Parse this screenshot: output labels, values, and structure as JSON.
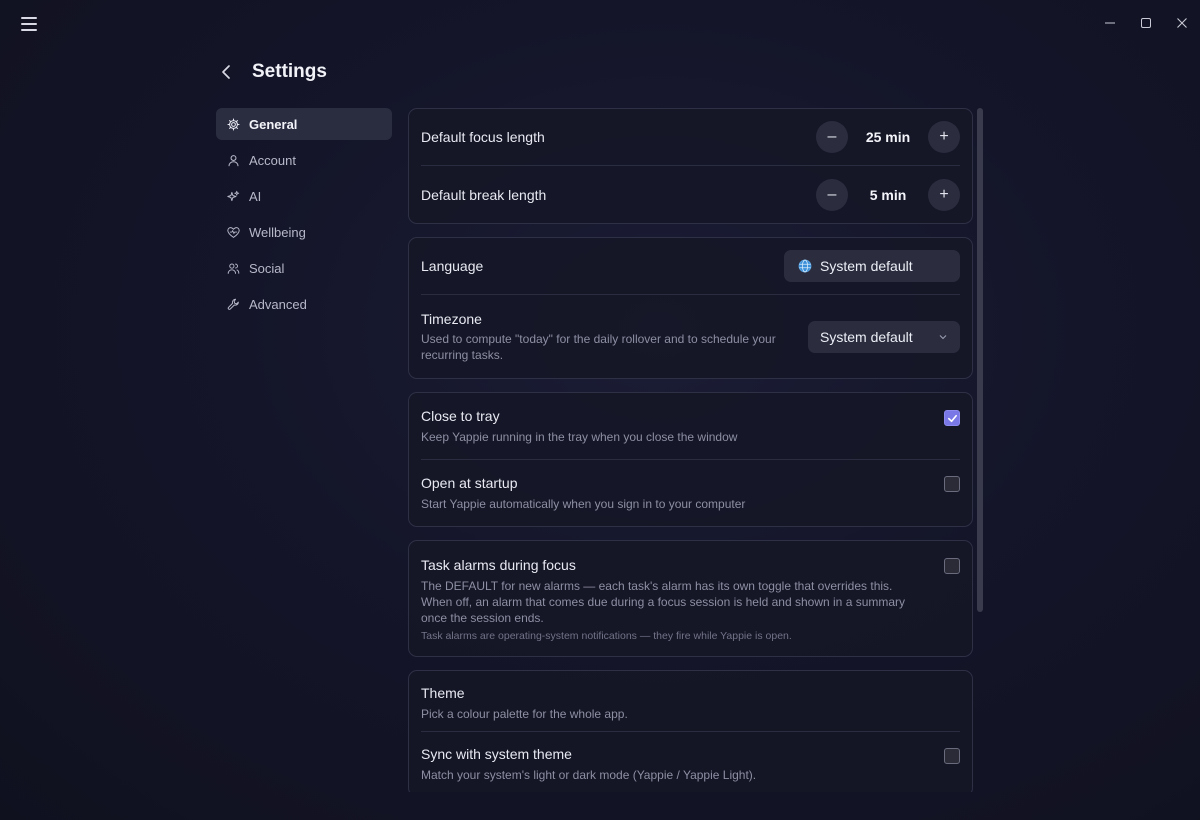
{
  "window": {
    "menu_icon": "hamburger-menu-icon",
    "minimize_icon": "minimize-icon",
    "maximize_icon": "maximize-icon",
    "close_icon": "close-icon"
  },
  "header": {
    "title": "Settings",
    "back_icon": "chevron-left-icon"
  },
  "sidebar": {
    "items": [
      {
        "label": "General",
        "icon": "gear-icon",
        "active": true
      },
      {
        "label": "Account",
        "icon": "user-icon",
        "active": false
      },
      {
        "label": "AI",
        "icon": "sparkles-icon",
        "active": false
      },
      {
        "label": "Wellbeing",
        "icon": "heart-pulse-icon",
        "active": false
      },
      {
        "label": "Social",
        "icon": "users-icon",
        "active": false
      },
      {
        "label": "Advanced",
        "icon": "wrench-icon",
        "active": false
      }
    ]
  },
  "timers": {
    "focus": {
      "label": "Default focus length",
      "value": "25 min"
    },
    "break": {
      "label": "Default break length",
      "value": "5 min"
    }
  },
  "locale": {
    "language": {
      "label": "Language",
      "value": "System default",
      "icon": "globe-icon"
    },
    "timezone": {
      "label": "Timezone",
      "description": "Used to compute \"today\" for the daily rollover and to schedule your recurring tasks.",
      "value": "System default"
    }
  },
  "window_behaviour": {
    "close_to_tray": {
      "label": "Close to tray",
      "description": "Keep Yappie running in the tray when you close the window",
      "checked": true
    },
    "open_at_startup": {
      "label": "Open at startup",
      "description": "Start Yappie automatically when you sign in to your computer",
      "checked": false
    }
  },
  "alarms": {
    "label": "Task alarms during focus",
    "description": "The DEFAULT for new alarms — each task's alarm has its own toggle that overrides this. When off, an alarm that comes due during a focus session is held and shown in a summary once the session ends.",
    "note": "Task alarms are operating-system notifications — they fire while Yappie is open.",
    "checked": false
  },
  "appearance": {
    "theme": {
      "label": "Theme",
      "description": "Pick a colour palette for the whole app."
    },
    "sync": {
      "label": "Sync with system theme",
      "description": "Match your system's light or dark mode (Yappie / Yappie Light).",
      "checked": false
    }
  },
  "colors": {
    "accent": "#7a77e6",
    "background": "#141529",
    "card": "#15162a",
    "control": "#2b2d3f"
  }
}
